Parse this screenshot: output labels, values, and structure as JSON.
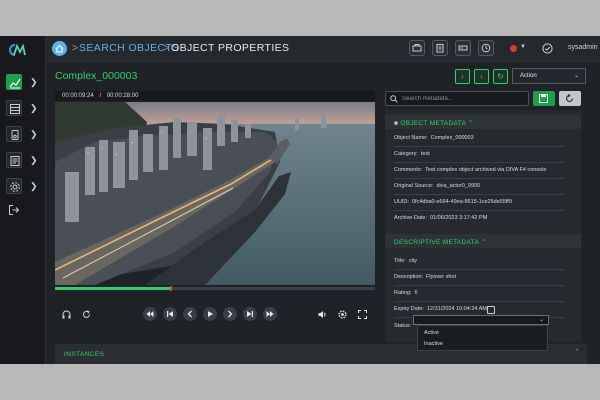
{
  "breadcrumb": {
    "root": "SEARCH OBJECTS",
    "current": "OBJECT PROPERTIES"
  },
  "user": {
    "name": "sysadmin"
  },
  "header": {
    "object_title": "Complex_000003",
    "action_label": "Action"
  },
  "player": {
    "current_time": "00:00:09:24",
    "separator": "/",
    "duration": "00:00:28:00",
    "progress_fraction": 0.36
  },
  "search": {
    "placeholder": "Search metadata..."
  },
  "object_metadata": {
    "title": "OBJECT METADATA",
    "fields": [
      {
        "label": "Object Name:",
        "value": "Complex_000003"
      },
      {
        "label": "Category:",
        "value": "test"
      },
      {
        "label": "Comments:",
        "value": "Test complex object archived via DIVA F# console"
      },
      {
        "label": "Original Source:",
        "value": "diva_actor0_9900"
      },
      {
        "label": "UUID:",
        "value": "0fc4dba0-e664-49ea-8615-1ce26de55ff9"
      },
      {
        "label": "Archive Date:",
        "value": "01/06/2023 3:17:42 PM"
      }
    ]
  },
  "descriptive_metadata": {
    "title": "DESCRIPTIVE METADATA",
    "fields": [
      {
        "label": "Title:",
        "value": "city"
      },
      {
        "label": "Description:",
        "value": "Flyover shot"
      },
      {
        "label": "Rating:",
        "value": "6"
      },
      {
        "label": "Expiry Date:",
        "value": "12/31/2024 10:04:24 AM"
      }
    ],
    "status_label": "Status:",
    "status_options": [
      "Active",
      "Inactive"
    ]
  },
  "instances": {
    "title": "INSTANCES"
  },
  "colors": {
    "accent": "#2fd16c",
    "background": "#1f2226",
    "panel": "#262a2f"
  },
  "icons": {
    "logo": "cm-logo-icon",
    "top_right": [
      "tape-library-icon",
      "clipboard-icon",
      "storage-icon",
      "history-icon",
      "record-status-icon",
      "check-circle-icon"
    ],
    "player": [
      "headphones-icon",
      "loop-icon",
      "rewind-icon",
      "skip-back-icon",
      "step-back-icon",
      "play-icon",
      "step-forward-icon",
      "skip-forward-icon",
      "fast-forward-icon",
      "volume-icon",
      "settings-icon",
      "fullscreen-icon"
    ]
  }
}
